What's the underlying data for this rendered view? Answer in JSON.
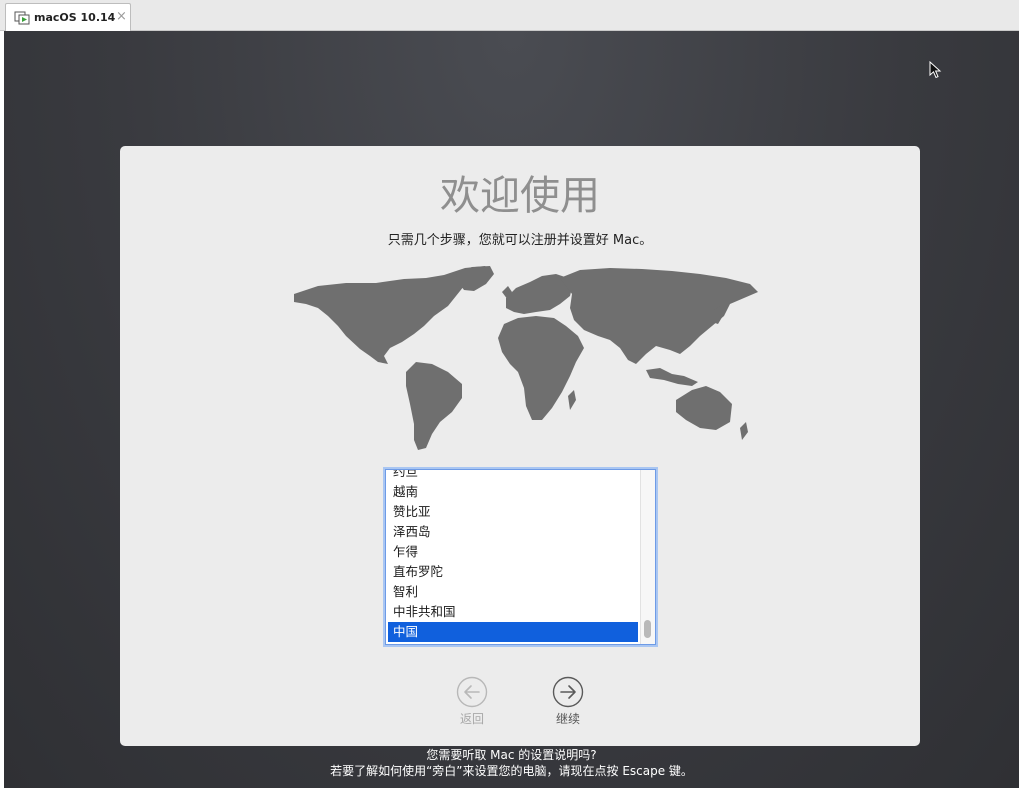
{
  "vm_tabs": [
    {
      "label": "macOS 10.14",
      "close_glyph": "×",
      "icon": "vm-icon"
    }
  ],
  "welcome": {
    "title": "欢迎使用",
    "subtitle": "只需几个步骤，您就可以注册并设置好 Mac。",
    "map_icon": "world-map",
    "countries": [
      "约旦",
      "越南",
      "赞比亚",
      "泽西岛",
      "乍得",
      "直布罗陀",
      "智利",
      "中非共和国",
      "中国"
    ],
    "selected_country": "中国",
    "back_label": "返回",
    "next_label": "继续"
  },
  "voiceover_hint": {
    "line1": "您需要听取 Mac 的设置说明吗?",
    "line2": "若要了解如何使用“旁白”来设置您的电脑，请现在点按 Escape 键。"
  },
  "colors": {
    "selection": "#1060dd",
    "panel": "#ececec",
    "map": "#6f6f6f",
    "desktop": "#393a3f"
  }
}
